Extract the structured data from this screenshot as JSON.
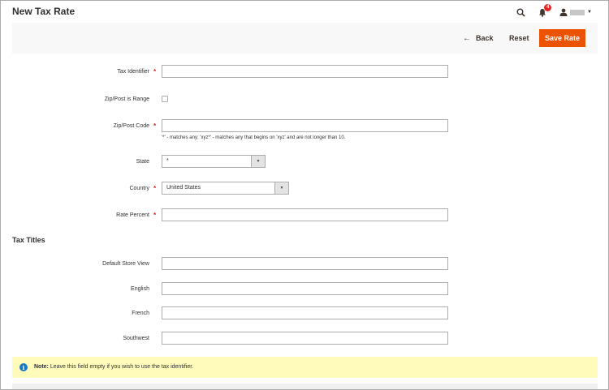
{
  "page": {
    "title": "New Tax Rate"
  },
  "header": {
    "notification_count": "4",
    "icons": [
      "search-icon",
      "bell-icon",
      "user-icon"
    ]
  },
  "actions": {
    "back_label": "Back",
    "reset_label": "Reset",
    "save_label": "Save Rate"
  },
  "form": {
    "tax_identifier": {
      "label": "Tax Identifier",
      "value": ""
    },
    "zip_is_range": {
      "label": "Zip/Post is Range",
      "checked": false
    },
    "zip_code": {
      "label": "Zip/Post Code",
      "value": "",
      "note": "'*' - matches any; 'xyz*' - matches any that begins on 'xyz' and are not longer than 10."
    },
    "state": {
      "label": "State",
      "selected": "*"
    },
    "country": {
      "label": "Country",
      "selected": "United States"
    },
    "rate_percent": {
      "label": "Rate Percent",
      "value": ""
    }
  },
  "tax_titles": {
    "title": "Tax Titles",
    "fields": [
      {
        "label": "Default Store View",
        "value": ""
      },
      {
        "label": "English",
        "value": ""
      },
      {
        "label": "French",
        "value": ""
      },
      {
        "label": "Southwest",
        "value": ""
      }
    ]
  },
  "note": {
    "label": "Note:",
    "text": "Leave this field empty if you wish to use the tax identifier."
  },
  "colors": {
    "accent": "#eb5202",
    "required": "#e22626",
    "info_bg": "#fffbbb",
    "info_icon": "#1979c3"
  }
}
